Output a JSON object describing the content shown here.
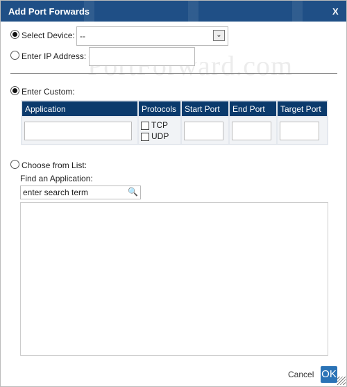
{
  "dialog": {
    "title": "Add Port Forwards",
    "close_label": "X"
  },
  "watermark": "PortForward.com",
  "device": {
    "select_label": "Select Device:",
    "selected": true,
    "value": "--",
    "ip_label": "Enter IP Address:",
    "ip_value": ""
  },
  "custom": {
    "label": "Enter Custom:",
    "selected": true,
    "columns": [
      "Application",
      "Protocols",
      "Start Port",
      "End Port",
      "Target Port"
    ],
    "protocols": [
      {
        "label": "TCP",
        "checked": false
      },
      {
        "label": "UDP",
        "checked": false
      }
    ]
  },
  "list": {
    "label": "Choose from List:",
    "selected": false,
    "find_label": "Find an Application:",
    "search_value": "enter search term",
    "icon": "magnifier-icon"
  },
  "footer": {
    "cancel_label": "Cancel",
    "ok_label": "OK"
  }
}
